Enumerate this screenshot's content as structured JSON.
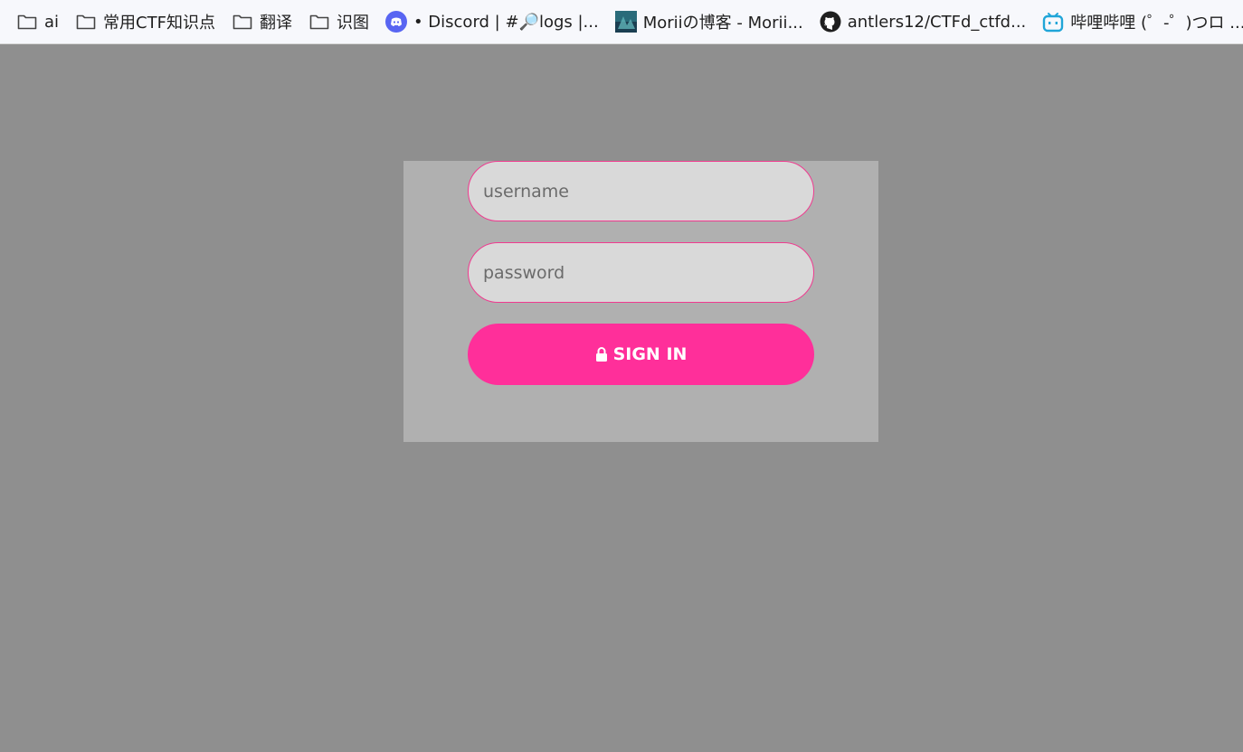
{
  "bookmarks": [
    {
      "label": "ai",
      "icon": "folder-icon"
    },
    {
      "label": "常用CTF知识点",
      "icon": "folder-icon"
    },
    {
      "label": "翻译",
      "icon": "folder-icon"
    },
    {
      "label": "识图",
      "icon": "folder-icon"
    },
    {
      "label": "• Discord | #🔎logs |...",
      "icon": "discord-icon"
    },
    {
      "label": "Moriiの博客 - Morii...",
      "icon": "site-thumbnail-icon"
    },
    {
      "label": "antlers12/CTFd_ctfd...",
      "icon": "github-icon"
    },
    {
      "label": "哔哩哔哩 (゜-゜)つロ ...",
      "icon": "bilibili-icon"
    }
  ],
  "login": {
    "username_placeholder": "username",
    "password_placeholder": "password",
    "signin_label": "SIGN IN",
    "signin_icon": "lock-icon"
  },
  "colors": {
    "page_bg": "#8f8f8f",
    "panel_bg": "#b0b0b0",
    "accent": "#ff2f9a",
    "field_border": "#ef3b8f",
    "field_bg": "#d9d9d9"
  }
}
